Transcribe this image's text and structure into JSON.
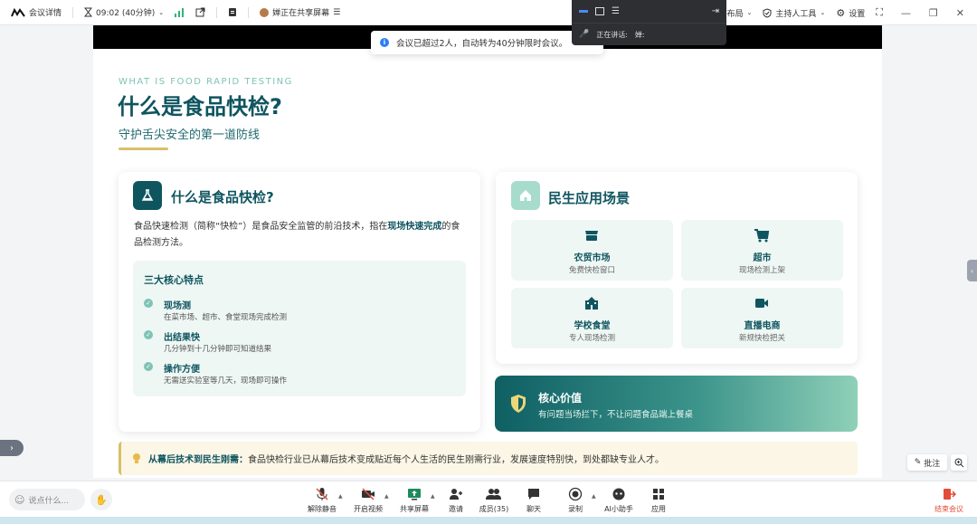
{
  "topbar": {
    "meeting_details": "会议详情",
    "timer": "09:02 (40分钟)",
    "sharing_status": "婵正在共享屏幕",
    "speaker_layout": "演讲者布局",
    "host_tools": "主持人工具",
    "settings": "设置"
  },
  "speaker_panel": {
    "label": "正在讲话:",
    "name": "婵:"
  },
  "toast": {
    "message": "会议已超过2人，自动转为40分钟限时会议。"
  },
  "slide": {
    "eyebrow": "WHAT IS FOOD RAPID TESTING",
    "title": "什么是食品快检?",
    "subtitle": "守护舌尖安全的第一道防线",
    "left_card": {
      "title": "什么是食品快检?",
      "desc_part1": "食品快速检测（简称“快检”）是食品安全监管的前沿技术，指在",
      "desc_bold": "现场快速完成",
      "desc_part2": "的食品检测方法。",
      "features_title": "三大核心特点",
      "features": [
        {
          "title": "现场测",
          "desc": "在菜市场、超市、食堂现场完成检测"
        },
        {
          "title": "出结果快",
          "desc": "几分钟到十几分钟即可知道结果"
        },
        {
          "title": "操作方便",
          "desc": "无需送实验室等几天，现场即可操作"
        }
      ]
    },
    "right_card": {
      "title": "民生应用场景",
      "scenes": [
        {
          "title": "农贸市场",
          "desc": "免费快检窗口"
        },
        {
          "title": "超市",
          "desc": "现场检测上架"
        },
        {
          "title": "学校食堂",
          "desc": "专人现场检测"
        },
        {
          "title": "直播电商",
          "desc": "新规快检把关"
        }
      ]
    },
    "value": {
      "title": "核心价值",
      "desc": "有问题当场拦下，不让问题食品端上餐桌"
    },
    "banner": {
      "bold": "从幕后技术到民生刚需：",
      "text": "食品快检行业已从幕后技术变成贴近每个人生活的民生刚需行业，发展速度特别快，到处都缺专业人才。"
    }
  },
  "annotate_label": "批注",
  "bottombar": {
    "chat_placeholder": "说点什么...",
    "tools": [
      {
        "label": "解除静音"
      },
      {
        "label": "开启视频"
      },
      {
        "label": "共享屏幕"
      },
      {
        "label": "邀请"
      },
      {
        "label": "成员(35)"
      },
      {
        "label": "聊天"
      },
      {
        "label": "录制"
      },
      {
        "label": "AI小助手"
      },
      {
        "label": "应用"
      }
    ],
    "end_meeting": "结束会议"
  },
  "colors": {
    "brand_teal": "#0f5560",
    "mint": "#7fc3b6",
    "gold": "#d8c06a",
    "danger": "#e24d3a"
  }
}
